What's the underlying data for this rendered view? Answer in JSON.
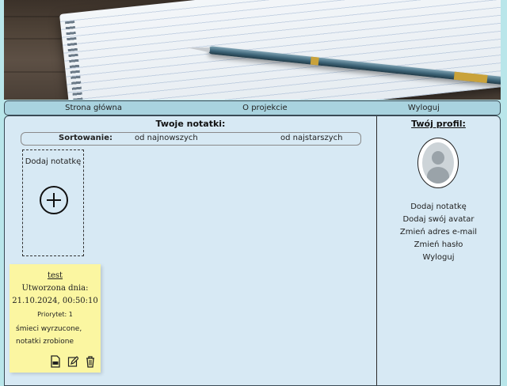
{
  "nav": {
    "home": "Strona główna",
    "about": "O projekcie",
    "logout": "Wyloguj"
  },
  "main": {
    "title": "Twoje notatki:",
    "sort": {
      "label": "Sortowanie:",
      "newest": "od najnowszych",
      "oldest": "od najstarszych"
    },
    "add_note_label": "Dodaj notatkę",
    "notes": [
      {
        "title": "test",
        "created_label": "Utworzona dnia:",
        "date": "21.10.2024, 00:50:10",
        "priority": "Priorytet: 1",
        "body_line1": "śmieci wyrzucone,",
        "body_line2": "notatki zrobione"
      }
    ],
    "note_icons": [
      "pdf-file-icon",
      "edit-icon",
      "trash-icon"
    ]
  },
  "profile": {
    "title": "Twój profil:",
    "menu": [
      "Dodaj notatkę",
      "Dodaj swój avatar",
      "Zmień adres e-mail",
      "Zmień hasło",
      "Wyloguj"
    ]
  },
  "colors": {
    "page_bg": "#b9e6ea",
    "panel_bg": "#d7e9f4",
    "nav_bg": "#a9d3df",
    "note_bg": "#fbf6a1"
  }
}
